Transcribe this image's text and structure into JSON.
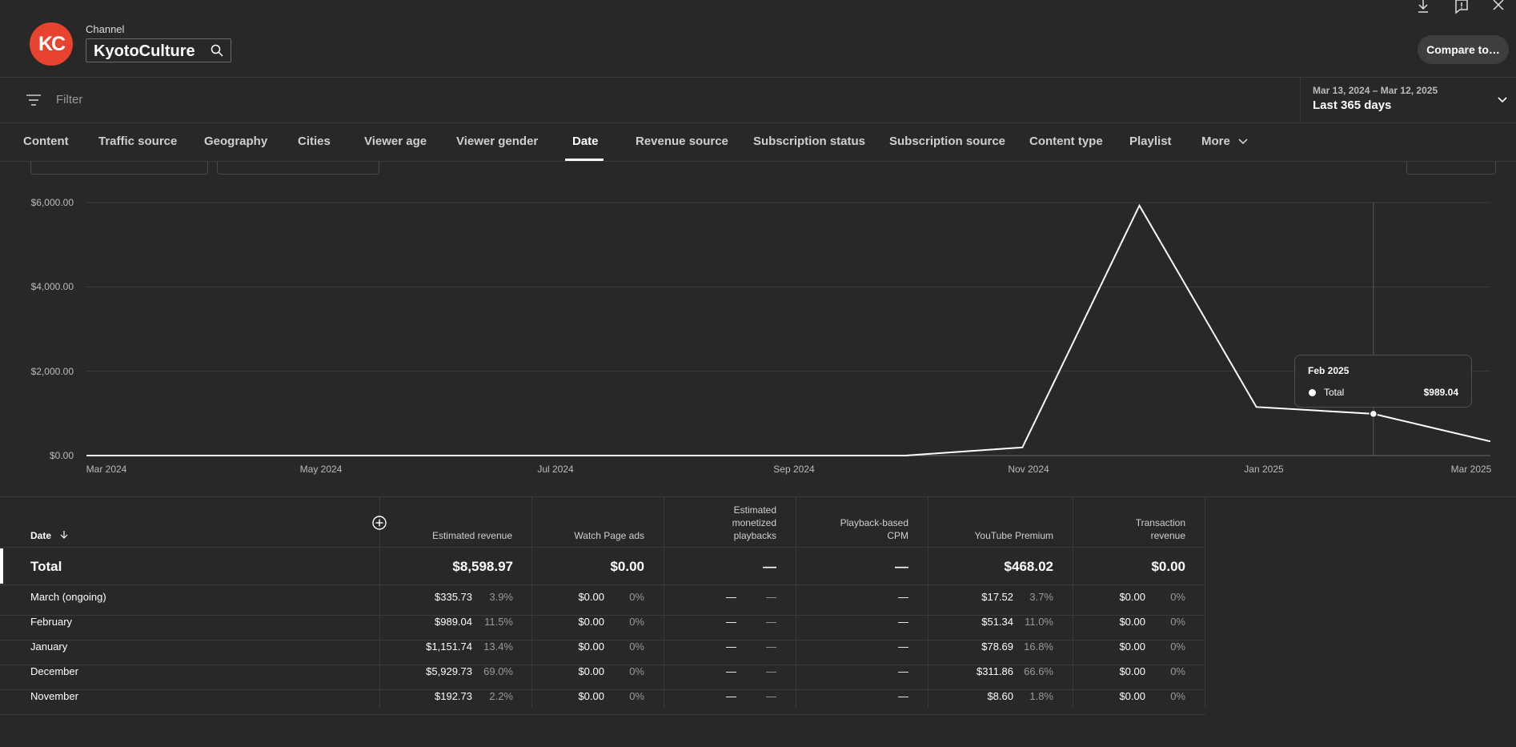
{
  "header": {
    "avatar_initials": "KC",
    "channel_label": "Channel",
    "channel_name": "KyotoCulture",
    "compare_label": "Compare to…",
    "icons": [
      "download-icon",
      "feedback-icon",
      "close-icon",
      "search-icon"
    ]
  },
  "filter": {
    "placeholder": "Filter"
  },
  "date_picker": {
    "range": "Mar 13, 2024 – Mar 12, 2025",
    "label": "Last 365 days"
  },
  "tabs": [
    {
      "label": "Content"
    },
    {
      "label": "Traffic source"
    },
    {
      "label": "Geography"
    },
    {
      "label": "Cities"
    },
    {
      "label": "Viewer age"
    },
    {
      "label": "Viewer gender"
    },
    {
      "label": "Date",
      "active": true
    },
    {
      "label": "Revenue source"
    },
    {
      "label": "Subscription status"
    },
    {
      "label": "Subscription source"
    },
    {
      "label": "Content type"
    },
    {
      "label": "Playlist"
    },
    {
      "label": "More"
    }
  ],
  "chart_data": {
    "type": "line",
    "y_ticks": [
      "$6,000.00",
      "$4,000.00",
      "$2,000.00",
      "$0.00"
    ],
    "ylim": [
      0,
      6000
    ],
    "x_ticks": [
      "Mar 2024",
      "May 2024",
      "Jul 2024",
      "Sep 2024",
      "Nov 2024",
      "Jan 2025",
      "Mar 2025"
    ],
    "x": [
      "Mar 2024",
      "Apr 2024",
      "May 2024",
      "Jun 2024",
      "Jul 2024",
      "Aug 2024",
      "Sep 2024",
      "Oct 2024",
      "Nov 2024",
      "Dec 2024",
      "Jan 2025",
      "Feb 2025",
      "Mar 2025"
    ],
    "series": [
      {
        "name": "Total",
        "values": [
          0,
          0,
          0,
          0,
          0,
          0,
          0,
          0,
          192.73,
          5929.73,
          1151.74,
          989.04,
          335.73
        ]
      }
    ],
    "grid": true,
    "highlight": {
      "title": "Feb 2025",
      "series": "Total",
      "value": "$989.04"
    },
    "color": "#ffffff"
  },
  "table": {
    "date_header": "Date",
    "columns": [
      "Estimated revenue",
      "Watch Page ads",
      "Estimated monetized playbacks",
      "Playback-based CPM",
      "YouTube Premium",
      "Transaction revenue"
    ],
    "total": {
      "label": "Total",
      "values": [
        "$8,598.97",
        "$0.00",
        "—",
        "—",
        "$468.02",
        "$0.00"
      ]
    },
    "rows": [
      {
        "date": "March (ongoing)",
        "rev": "$335.73",
        "rev_pct": "3.9%",
        "wpa": "$0.00",
        "wpa_pct": "0%",
        "emp": "—",
        "emp_pct": "—",
        "cpm": "—",
        "ytp": "$17.52",
        "ytp_pct": "3.7%",
        "tr": "$0.00",
        "tr_pct": "0%"
      },
      {
        "date": "February",
        "rev": "$989.04",
        "rev_pct": "11.5%",
        "wpa": "$0.00",
        "wpa_pct": "0%",
        "emp": "—",
        "emp_pct": "—",
        "cpm": "—",
        "ytp": "$51.34",
        "ytp_pct": "11.0%",
        "tr": "$0.00",
        "tr_pct": "0%"
      },
      {
        "date": "January",
        "rev": "$1,151.74",
        "rev_pct": "13.4%",
        "wpa": "$0.00",
        "wpa_pct": "0%",
        "emp": "—",
        "emp_pct": "—",
        "cpm": "—",
        "ytp": "$78.69",
        "ytp_pct": "16.8%",
        "tr": "$0.00",
        "tr_pct": "0%"
      },
      {
        "date": "December",
        "rev": "$5,929.73",
        "rev_pct": "69.0%",
        "wpa": "$0.00",
        "wpa_pct": "0%",
        "emp": "—",
        "emp_pct": "—",
        "cpm": "—",
        "ytp": "$311.86",
        "ytp_pct": "66.6%",
        "tr": "$0.00",
        "tr_pct": "0%"
      },
      {
        "date": "November",
        "rev": "$192.73",
        "rev_pct": "2.2%",
        "wpa": "$0.00",
        "wpa_pct": "0%",
        "emp": "—",
        "emp_pct": "—",
        "cpm": "—",
        "ytp": "$8.60",
        "ytp_pct": "1.8%",
        "tr": "$0.00",
        "tr_pct": "0%"
      }
    ]
  }
}
